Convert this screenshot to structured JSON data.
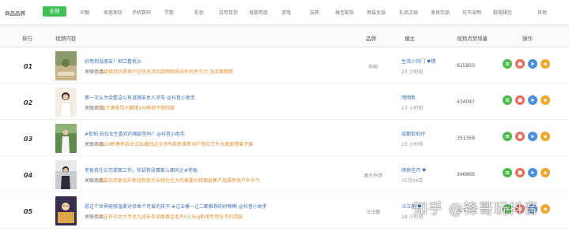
{
  "category_bar": {
    "label": "商品品牌",
    "all_label": "全部",
    "categories": [
      "中靓",
      "家居家纺",
      "手机数码",
      "学数",
      "彩妆",
      "日用百货",
      "母婴用品",
      "游戏",
      "玩具",
      "珠宝配饰",
      "男装女装",
      "礼品文娱",
      "美食饮品",
      "花鸟宠物",
      "鞋帽箱包",
      "其他"
    ]
  },
  "table": {
    "headers": {
      "rank": "排行",
      "video": "视频内容",
      "brand": "品牌",
      "blogger": "播主",
      "sales": "视频点赞增量",
      "ops": "操作"
    },
    "product_label": "关联商品:",
    "rows": [
      {
        "rank": "01",
        "title": "好用到没朋友！担口看机沙",
        "product": "戊级极品优质茶叶区热无添加绿雨丽质线有机性节力 茂活面精精",
        "brand": "毕昭",
        "blogger": "生活小窍门 ♥精",
        "time": "23 小时前",
        "sales": "615850"
      },
      {
        "rank": "02",
        "title": "第一次认为会整这么有道理非女人凉车 @抖音小助手",
        "product": "[没大满美带大棚精1元鲜桃不够回复",
        "brand": "",
        "blogger": "明明新",
        "time": "23 小时前",
        "sales": "434047"
      },
      {
        "rank": "03",
        "title": "#街拍 玩拉女生喜欢的哪款型吗？@抖音小助手",
        "product": "2019新春新款女式私藏独运全场有款新事新词户制应订片长面佩情套子套",
        "brand": "",
        "blogger": "成都街拍仔",
        "time": "23 小时前",
        "sales": "351358"
      },
      {
        "rank": "04",
        "title": "老板我在公司拿面工作，你却我张寡那么面问之#老板",
        "product": "纺款衣而更加斤新轻新款次长翔住在大码着要价就面层售产品属新供户外半气",
        "brand": "澳大乔伊",
        "blogger": "明俏佳开 ♥",
        "time": "05月06日",
        "sales": "346866"
      },
      {
        "rank": "05",
        "title": "愿这个世界能够温柔对待每个可爱的孩子 #过五模一让二都推荐的好物啊 @抖音小助手",
        "product": "汪注有中太大专员九成长条场面香金毛片F2.5kg斯用专用兑不的回装",
        "brand": "汪汪菌",
        "blogger": "汪汪菌 ♥",
        "time": "18 小时前",
        "sales": "317"
      }
    ]
  },
  "ops_icons": [
    "stats-icon",
    "shop-icon",
    "play-icon",
    "star-icon"
  ],
  "ops_colors": [
    "#4cb84c",
    "#e46a5a",
    "#4a8fd8",
    "#f0a62a"
  ],
  "watermark": "知乎 @锋哥玩抖音"
}
